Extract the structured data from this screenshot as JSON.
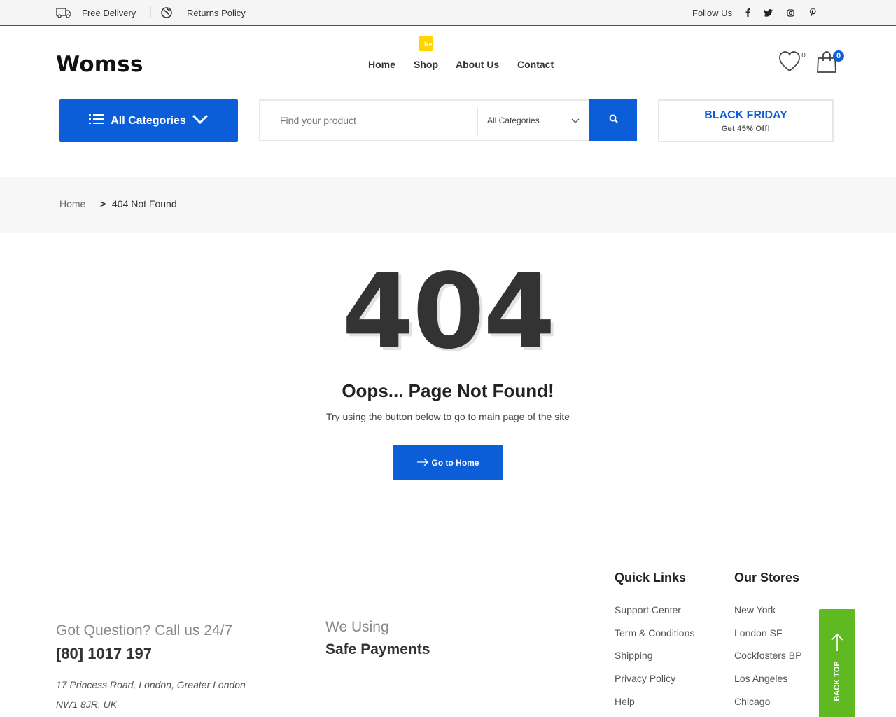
{
  "topbar": {
    "free_delivery": "Free Delivery",
    "returns_policy": "Returns Policy",
    "follow_us": "Follow Us",
    "social_icons": [
      "facebook-icon",
      "twitter-icon",
      "instagram-icon",
      "pinterest-icon"
    ]
  },
  "header": {
    "logo": "Womss",
    "nav": [
      {
        "label": "Home"
      },
      {
        "label": "Shop",
        "tag": "Ne"
      },
      {
        "label": "About Us"
      },
      {
        "label": "Contact"
      }
    ],
    "wishlist_count": "0",
    "cart_count": "0"
  },
  "category_button": {
    "label": "All Categories"
  },
  "search": {
    "placeholder": "Find your product",
    "category_selected": "All Categories"
  },
  "promo": {
    "title": "BLACK FRIDAY",
    "subtitle": "Get 45% Off!"
  },
  "breadcrumb": {
    "home": "Home",
    "separator": ">",
    "current": "404 Not Found"
  },
  "error": {
    "code": "404",
    "title": "Oops... Page Not Found!",
    "message": "Try using the button below to go to main page of the site",
    "button": "Go to Home"
  },
  "footer": {
    "question": "Got Question? Call us 24/7",
    "phone": "[80] 1017 197",
    "address": "17 Princess Road, London, Greater London NW1 8JR, UK",
    "we_using": "We Using",
    "safe_payments": "Safe Payments",
    "quick_links_title": "Quick Links",
    "quick_links": [
      "Support Center",
      "Term & Conditions",
      "Shipping",
      "Privacy Policy",
      "Help"
    ],
    "stores_title": "Our Stores",
    "stores": [
      "New York",
      "London SF",
      "Cockfosters BP",
      "Los Angeles",
      "Chicago"
    ],
    "back_top": "BACK TOP"
  },
  "colors": {
    "primary": "#0b5ed7",
    "back_top": "#5fb921",
    "new_tag": "#ffd400"
  }
}
